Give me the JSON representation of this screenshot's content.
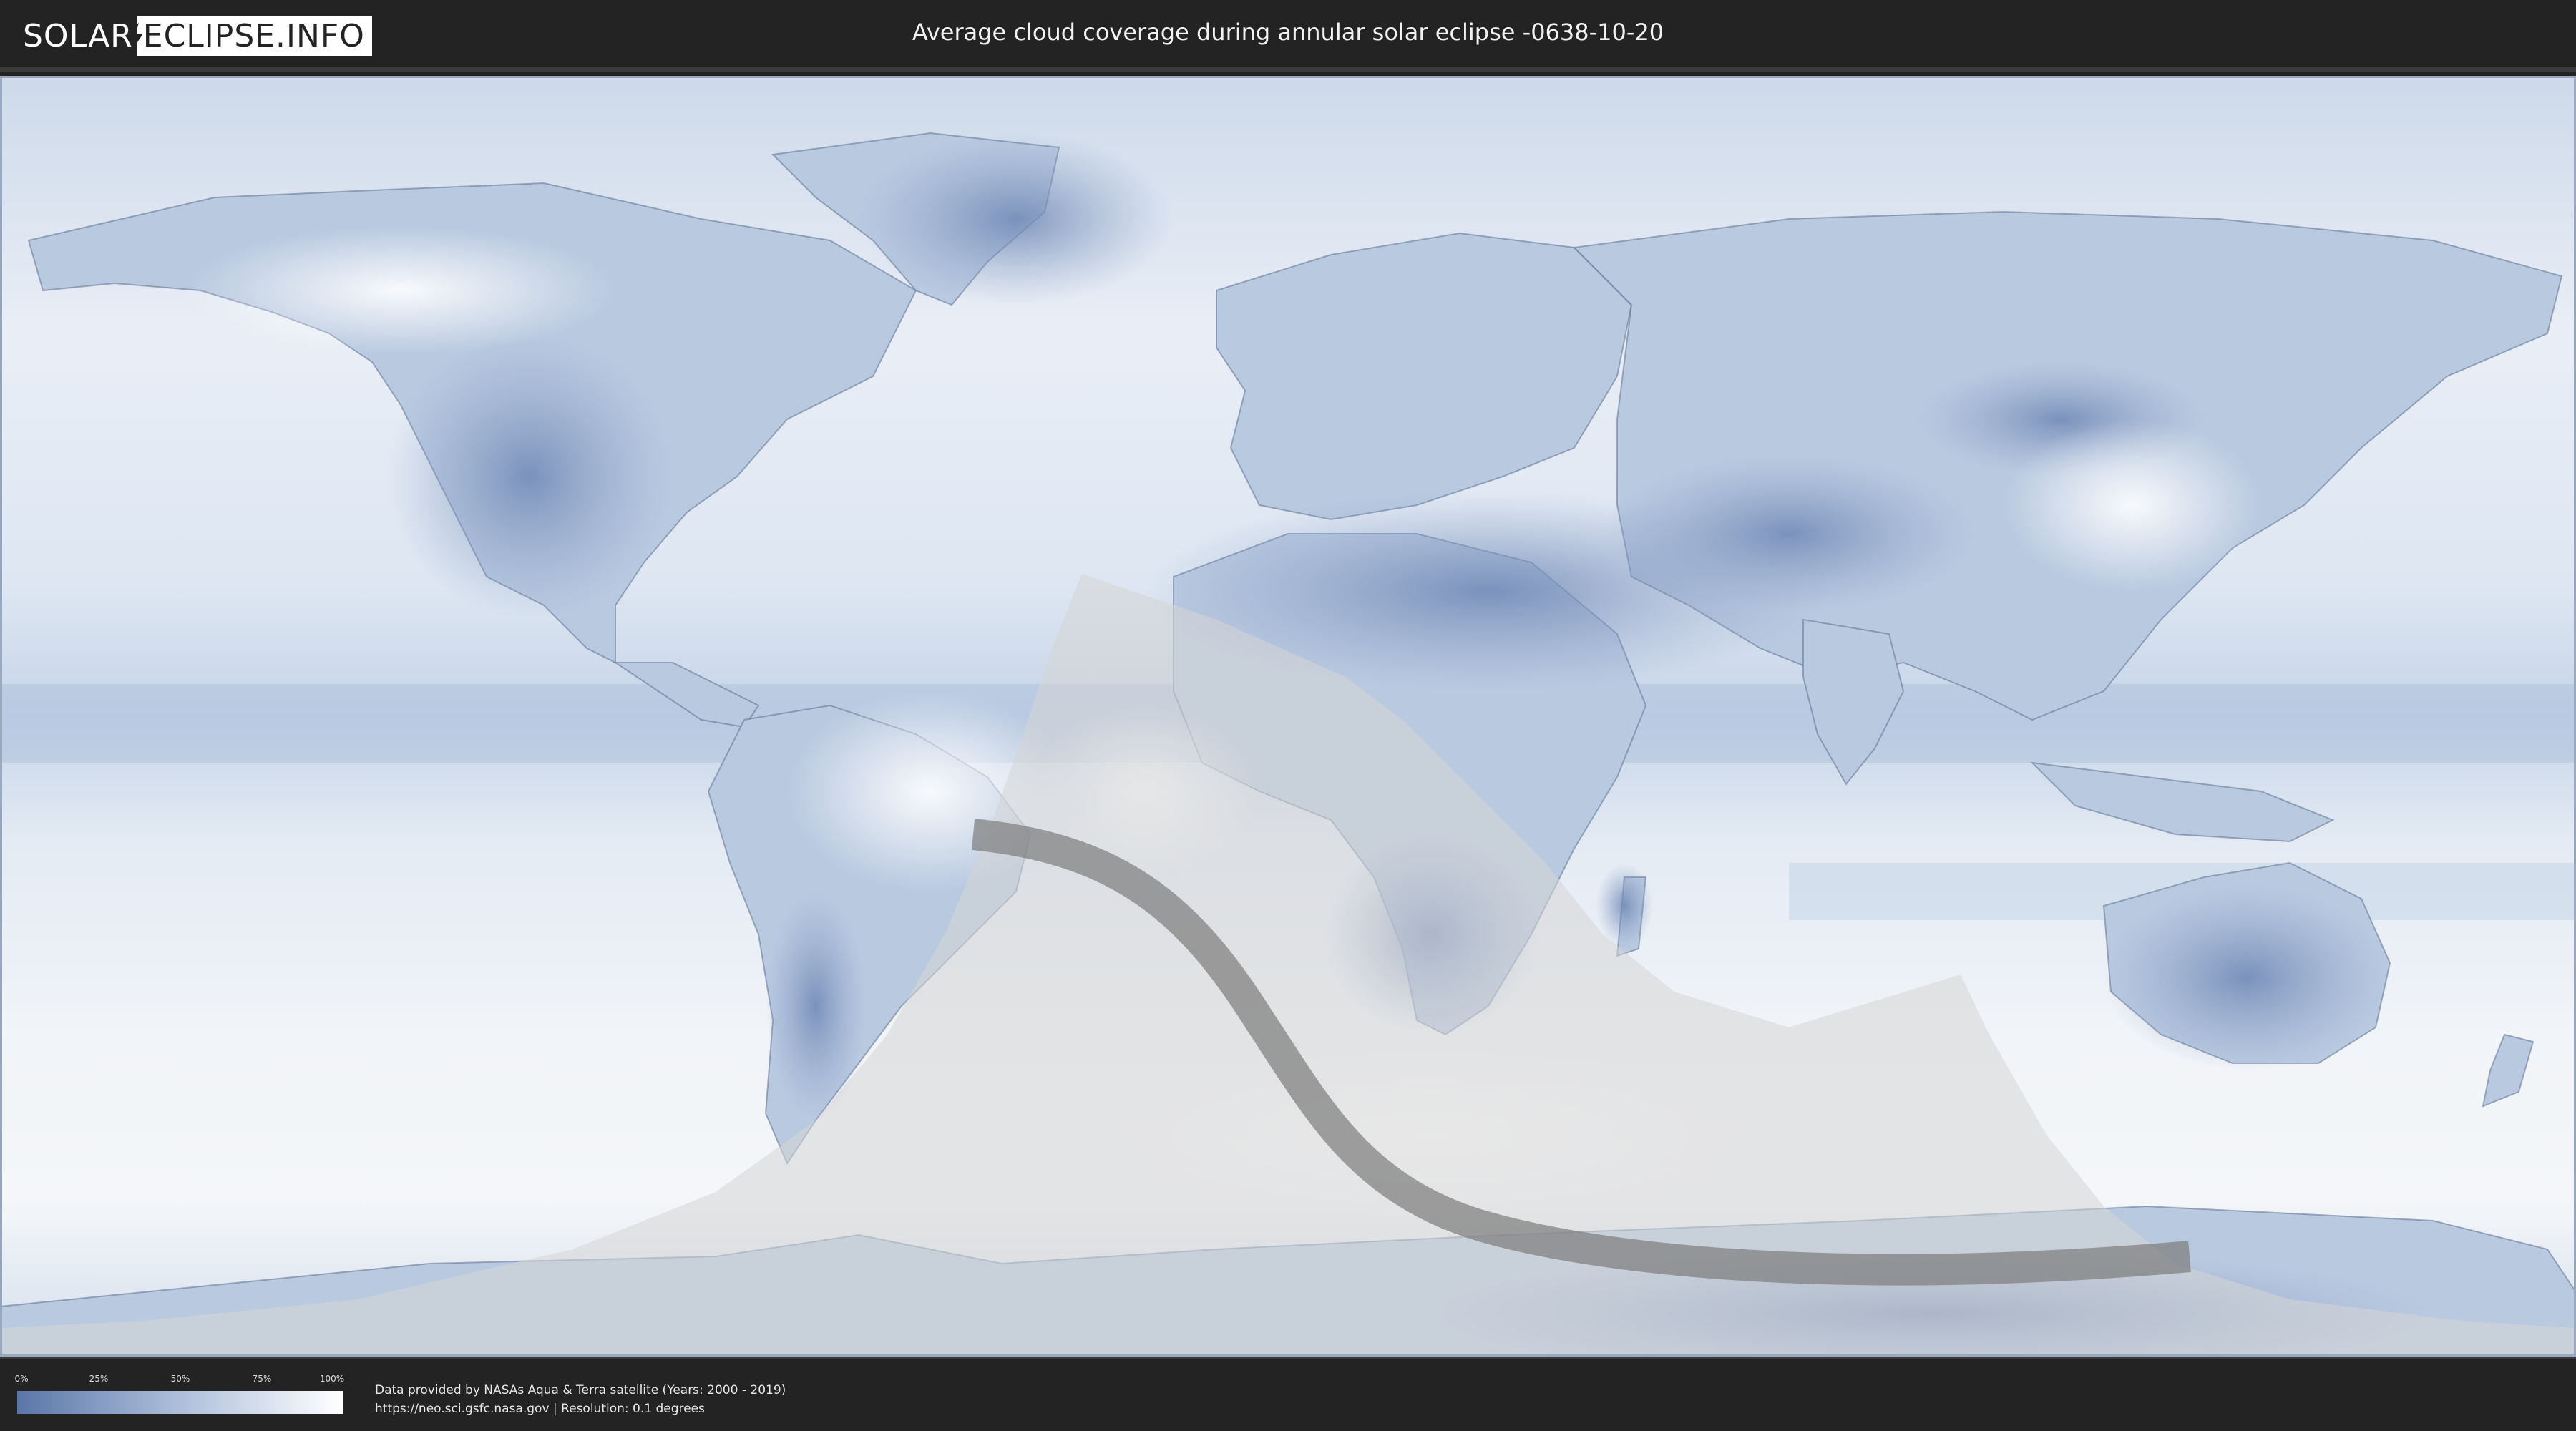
{
  "header": {
    "logo_part1": "SOLAR",
    "logo_part2": "ECLIPSE.INFO",
    "title": "Average cloud coverage during annular solar eclipse -0638-10-20"
  },
  "legend": {
    "ticks": [
      "0%",
      "25%",
      "50%",
      "75%",
      "100%"
    ],
    "color_low": "#5a76a8",
    "color_high": "#ffffff"
  },
  "credits": {
    "line1": "Data provided by NASAs Aqua & Terra satellite (Years: 2000 - 2019)",
    "line2_link": "https://neo.sci.gsfc.nasa.gov",
    "line2_sep": " | ",
    "line2_res": "Resolution: 0.1 degrees"
  },
  "colors": {
    "ocean_cloud": "#e8eef6",
    "clear_land": "#6f8ab7",
    "eclipse_zone": "#d8d8d8",
    "eclipse_path": "#7a7a7a",
    "border": "#3c4b66"
  }
}
